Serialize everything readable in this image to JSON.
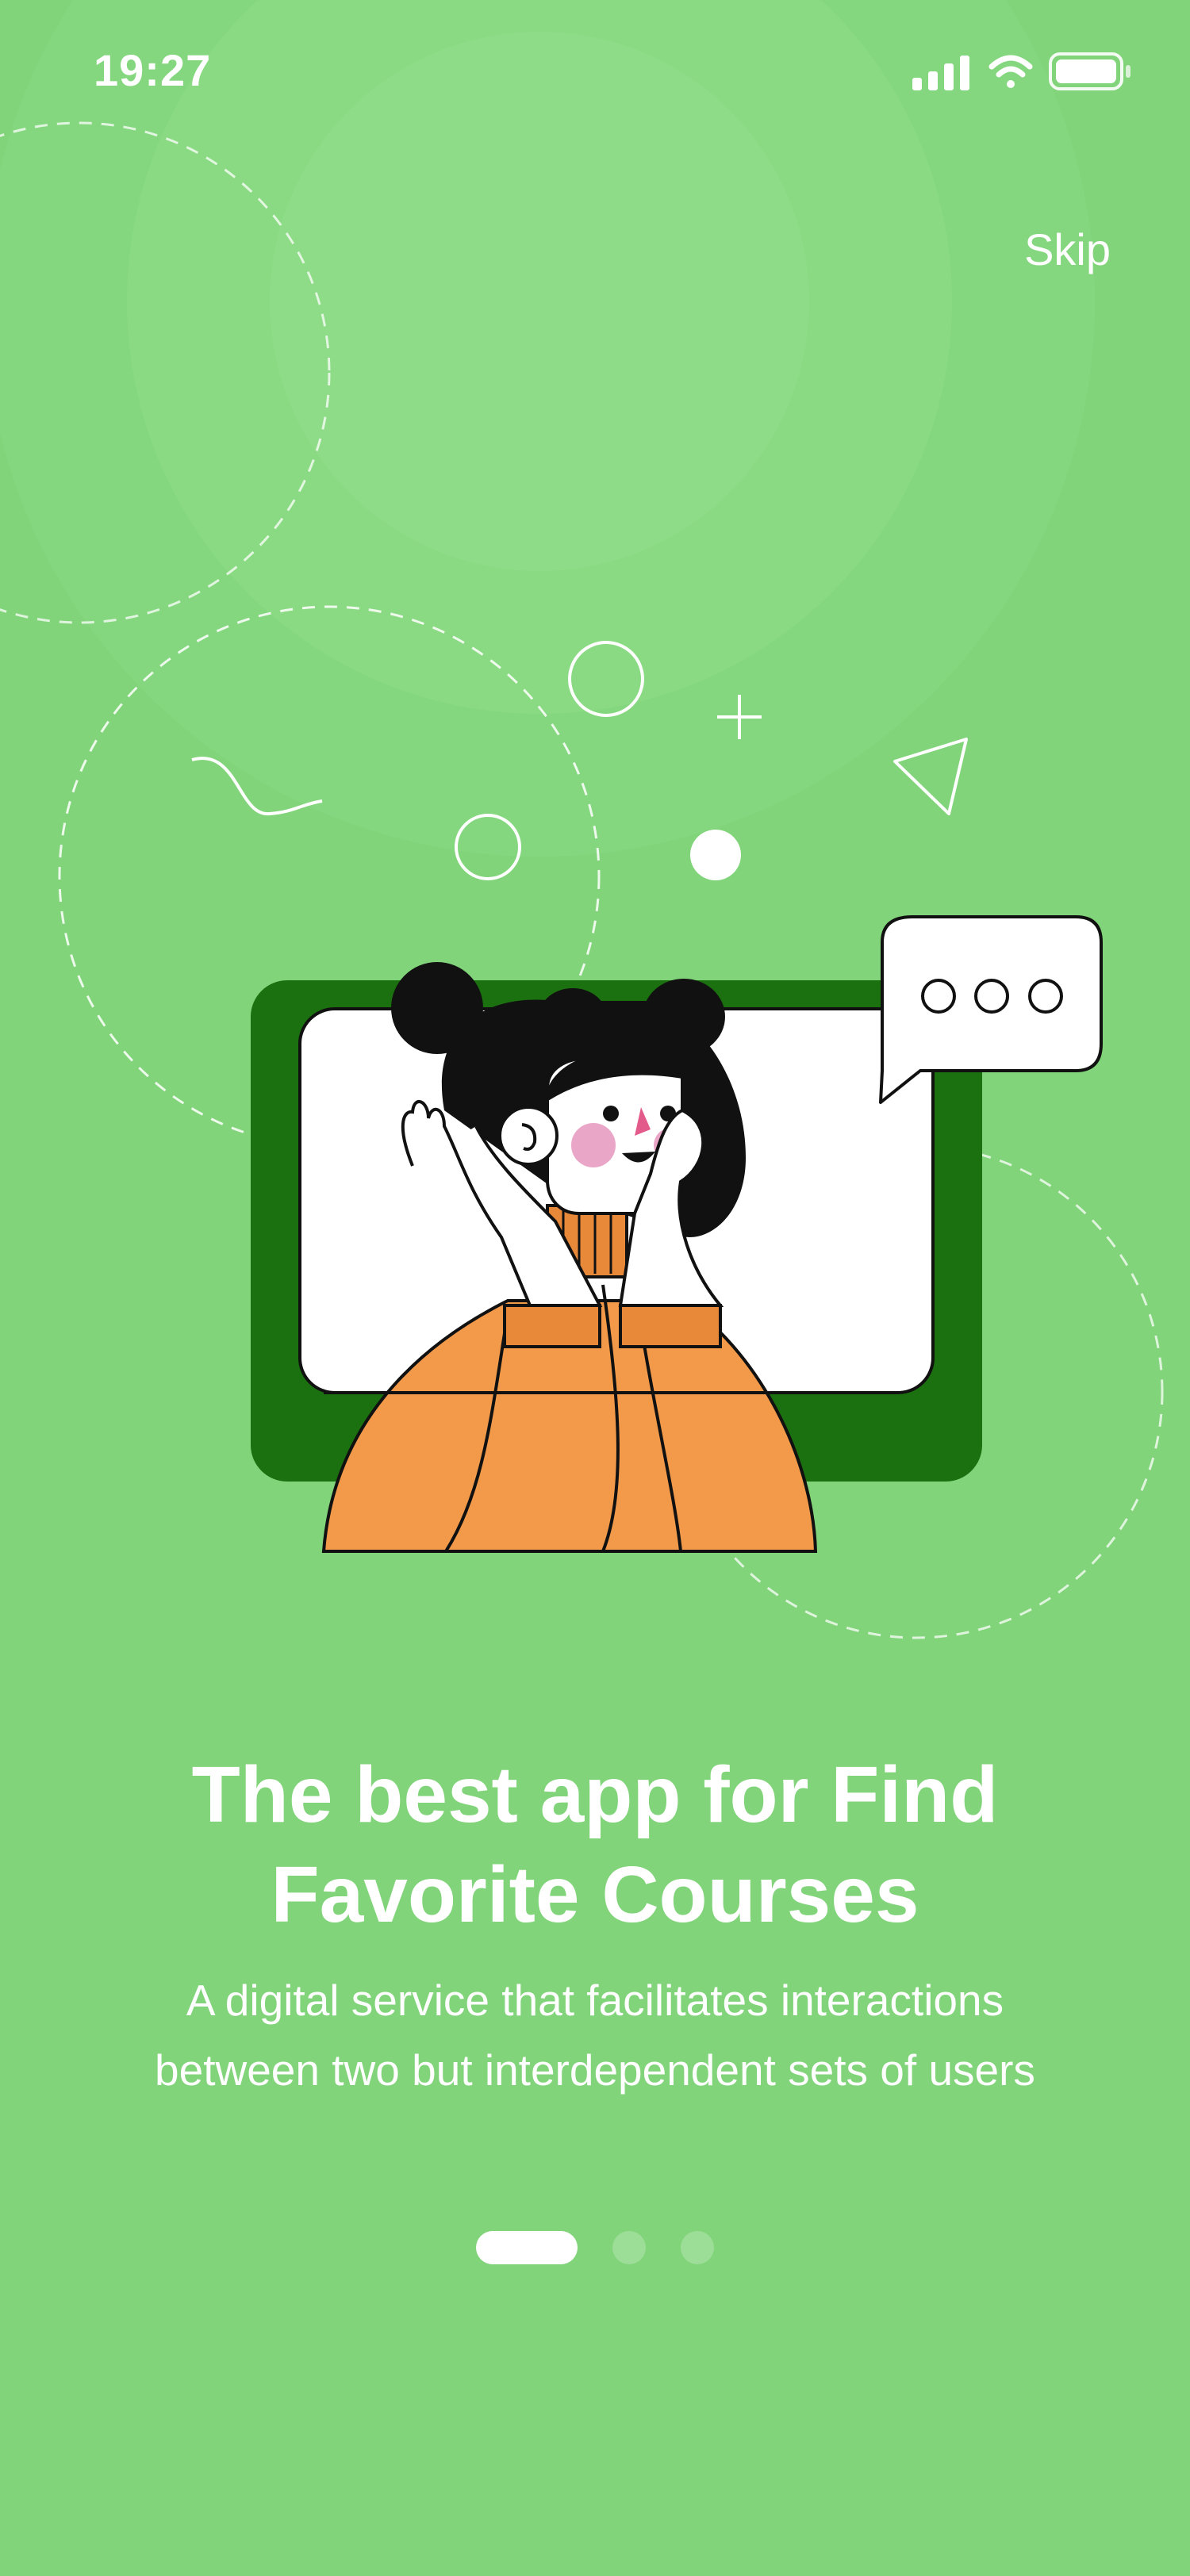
{
  "status_bar": {
    "time": "19:27",
    "icons": [
      "cellular-signal-icon",
      "wifi-icon",
      "battery-icon"
    ]
  },
  "header": {
    "skip_label": "Skip"
  },
  "onboarding": {
    "title": "The best app for Find Favorite Courses",
    "description": "A digital service that facilitates interactions between two but interdependent sets of users",
    "page_indicator": {
      "total": 3,
      "current": 1
    }
  },
  "colors": {
    "background": "#81d47a",
    "screen_frame": "#1b700f",
    "sweater": "#f29a4a",
    "text": "#ffffff"
  }
}
